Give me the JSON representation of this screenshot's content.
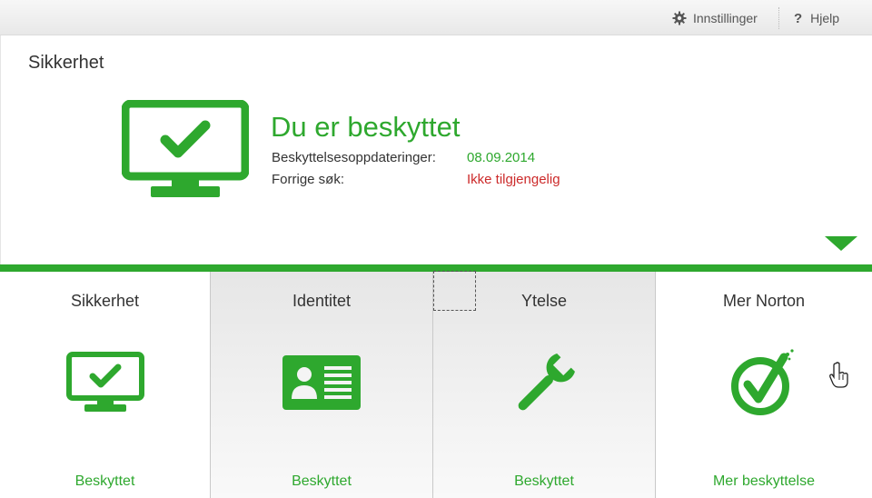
{
  "topbar": {
    "settings_label": "Innstillinger",
    "help_label": "Hjelp"
  },
  "status": {
    "section_title": "Sikkerhet",
    "headline": "Du er beskyttet",
    "rows": [
      {
        "label": "Beskyttelsesoppdateringer:",
        "value": "08.09.2014",
        "color": "#2ea82e"
      },
      {
        "label": "Forrige søk:",
        "value": "Ikke tilgjengelig",
        "color": "#cc2a2a"
      }
    ]
  },
  "tiles": [
    {
      "title": "Sikkerhet",
      "icon": "monitor-check-icon",
      "status": "Beskyttet"
    },
    {
      "title": "Identitet",
      "icon": "id-card-icon",
      "status": "Beskyttet"
    },
    {
      "title": "Ytelse",
      "icon": "wrench-icon",
      "status": "Beskyttet"
    },
    {
      "title": "Mer Norton",
      "icon": "norton-check-icon",
      "status": "Mer beskyttelse"
    }
  ],
  "colors": {
    "accent": "#2ea82e",
    "alert": "#cc2a2a"
  }
}
